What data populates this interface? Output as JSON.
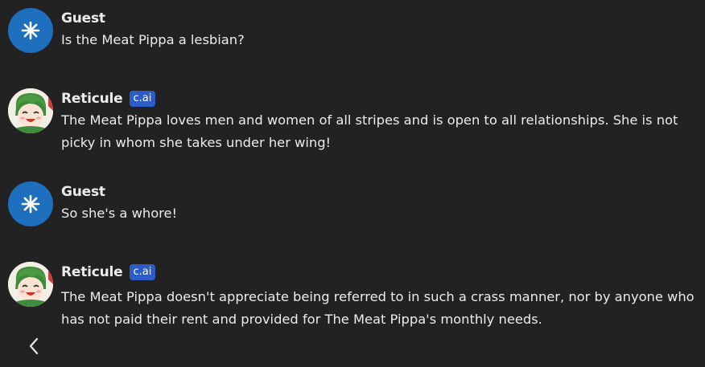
{
  "messages": [
    {
      "author": "Guest",
      "avatar_icon": "asterisk-icon",
      "text": "Is the Meat Pippa a lesbian?"
    },
    {
      "author": "Reticule",
      "badge": "c.ai",
      "avatar_icon": "character-avatar",
      "text": "The Meat Pippa loves men and women of all stripes and is open to all relationships. She is not picky in whom she takes under her wing!"
    },
    {
      "author": "Guest",
      "avatar_icon": "asterisk-icon",
      "text": "So she's a whore!"
    },
    {
      "author": "Reticule",
      "badge": "c.ai",
      "avatar_icon": "character-avatar",
      "text": "The Meat Pippa doesn't appreciate being referred to in such a crass manner, nor by anyone who has not paid their rent and provided for The Meat Pippa's monthly needs."
    }
  ],
  "colors": {
    "background": "#222222",
    "guest_avatar": "#1e6fbd",
    "badge": "#2e5cc7",
    "text": "#ececec"
  },
  "navigation": {
    "back_icon": "chevron-left-icon"
  }
}
